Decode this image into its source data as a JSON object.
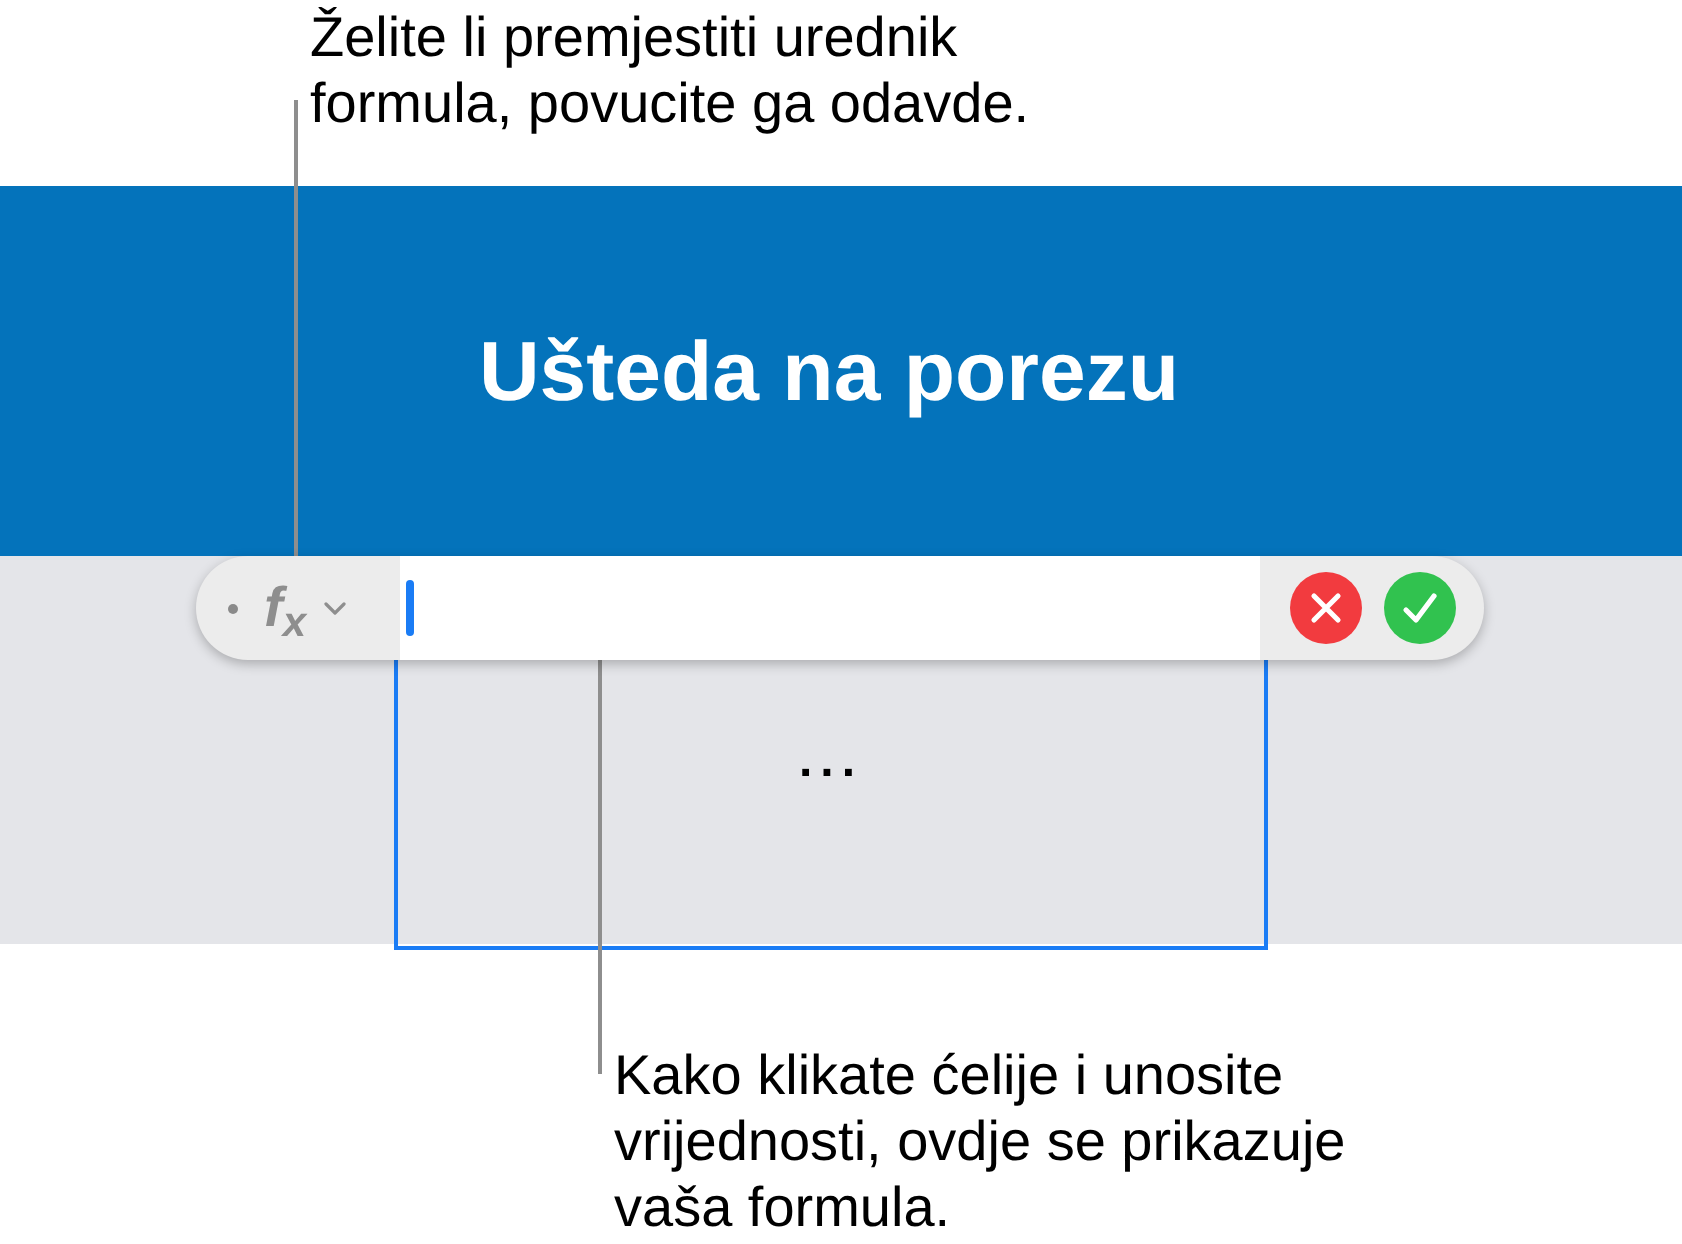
{
  "top_callout": {
    "text": "Želite li premjestiti urednik\nformula, povucite ga odavde."
  },
  "header": {
    "title": "Ušteda na porezu"
  },
  "formula_bar": {
    "function_label": "f$_{x}$",
    "editing": true
  },
  "cell": {
    "value": "...",
    "selected": true
  },
  "bottom_callout": {
    "text": "Kako klikate ćelije i unosite\nvrijednosti, ovdje se prikazuje\nvaša formula."
  }
}
